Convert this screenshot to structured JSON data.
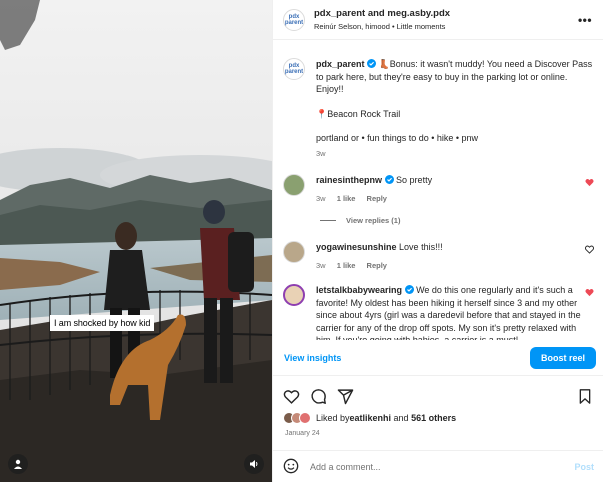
{
  "media": {
    "caption_overlay": "I am shocked by how kid"
  },
  "header": {
    "title": "pdx_parent and meg.asby.pdx",
    "subtitle": "Reinúr Selson, himood • Little moments",
    "avatar_logo": "pdx parent"
  },
  "caption": {
    "username": "pdx_parent",
    "text": "👢Bonus: it wasn't muddy! You need a Discover Pass to park here, but they're easy to buy in the parking lot or online. Enjoy!!",
    "location": "📍Beacon Rock Trail",
    "tags": "portland or • fun things to do • hike • pnw",
    "time": "3w"
  },
  "comments": [
    {
      "username": "rainesinthepnw",
      "text": "So pretty",
      "time": "3w",
      "likes": "1 like",
      "reply": "Reply",
      "liked": true
    },
    {
      "username": "yogawinesunshine",
      "text": "Love this!!!",
      "time": "3w",
      "likes": "1 like",
      "reply": "Reply",
      "liked": false
    },
    {
      "username": "letstalkbabywearing",
      "text": "We do this one regularly and it's such a favorite! My oldest has been hiking it herself since 3 and my other since about 4yrs (girl was a daredevil before that and stayed in the carrier for any of the drop off spots. My son it's pretty relaxed with him. If you're going with babies, a carrier is a must!",
      "liked": true
    }
  ],
  "view_replies": "View replies (1)",
  "insights": {
    "link": "View insights",
    "boost": "Boost reel"
  },
  "likes": {
    "prefix": "Liked by ",
    "user": "eatlikenhi",
    "middle": " and ",
    "others": "561 others"
  },
  "date": "January 24",
  "add_comment": {
    "placeholder": "Add a comment...",
    "post": "Post"
  },
  "colors": {
    "accent": "#0095f6",
    "heart": "#ed4956",
    "verified": "#0095f6",
    "muted": "#737373"
  }
}
